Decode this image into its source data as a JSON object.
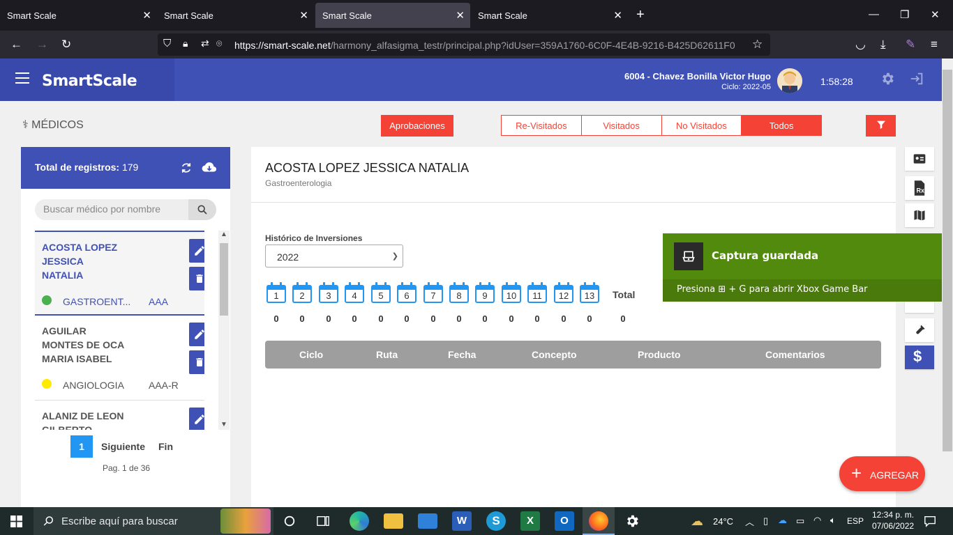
{
  "browser": {
    "tabs": [
      {
        "title": "Smart Scale",
        "active": false
      },
      {
        "title": "Smart Scale",
        "active": false
      },
      {
        "title": "Smart Scale",
        "active": true
      },
      {
        "title": "Smart Scale",
        "active": false
      }
    ],
    "url_domain": "https://smart-scale.net",
    "url_path": "/harmony_alfasigma_testr/principal.php?idUser=359A1760-6C0F-4E4B-9216-B425D62611F0"
  },
  "header": {
    "brand": "SmartScale",
    "user": "6004 - Chavez Bonilla Victor Hugo",
    "cycle": "Ciclo: 2022-05",
    "timer": "1:58:28"
  },
  "section": {
    "title": "MÉDICOS",
    "approvals_label": "Aprobaciones",
    "filters": [
      "Re-Visitados",
      "Visitados",
      "No Visitados",
      "Todos"
    ],
    "active_filter": "Todos"
  },
  "list": {
    "total_label": "Total de registros:",
    "total": "179",
    "search_placeholder": "Buscar médico por nombre",
    "doctors": [
      {
        "name_l1": "ACOSTA LOPEZ",
        "name_l2": "JESSICA",
        "name_l3": "NATALIA",
        "specialty": "GASTROENT...",
        "class": "AAA",
        "dot_color": "#4caf50",
        "selected": true
      },
      {
        "name_l1": "AGUILAR",
        "name_l2": "MONTES DE OCA",
        "name_l3": "MARIA ISABEL",
        "specialty": "ANGIOLOGIA",
        "class": "AAA-R",
        "dot_color": "#ffeb00",
        "selected": false
      },
      {
        "name_l1": "ALANIZ DE LEON",
        "name_l2": "GILBERTO",
        "name_l3": "",
        "specialty": "",
        "class": "",
        "dot_color": "",
        "selected": false
      }
    ],
    "pager": {
      "page": "1",
      "next": "Siguiente",
      "last": "Fin",
      "info": "Pag. 1 de 36"
    }
  },
  "detail": {
    "name": "ACOSTA LOPEZ JESSICA NATALIA",
    "specialty": "Gastroenterologia",
    "history_label": "Histórico de Inversiones",
    "year": "2022",
    "months": [
      "1",
      "2",
      "3",
      "4",
      "5",
      "6",
      "7",
      "8",
      "9",
      "10",
      "11",
      "12",
      "13"
    ],
    "values": [
      "0",
      "0",
      "0",
      "0",
      "0",
      "0",
      "0",
      "0",
      "0",
      "0",
      "0",
      "0",
      "0"
    ],
    "total_label": "Total",
    "total": "0",
    "table_headers": [
      "Ciclo",
      "Ruta",
      "Fecha",
      "Concepto",
      "Producto",
      "Comentarios"
    ]
  },
  "toast": {
    "title": "Captura guardada",
    "message": "Presiona ⊞ + G para abrir Xbox Game Bar"
  },
  "fab": {
    "label": "AGREGAR"
  },
  "taskbar": {
    "search_placeholder": "Escribe aquí para buscar",
    "temperature": "24°C",
    "language": "ESP",
    "time": "12:34 p. m.",
    "date": "07/06/2022"
  },
  "colors": {
    "primary": "#3f51b5",
    "accent": "#f44336",
    "toast": "#528a0d",
    "calendar": "#2196f3"
  }
}
